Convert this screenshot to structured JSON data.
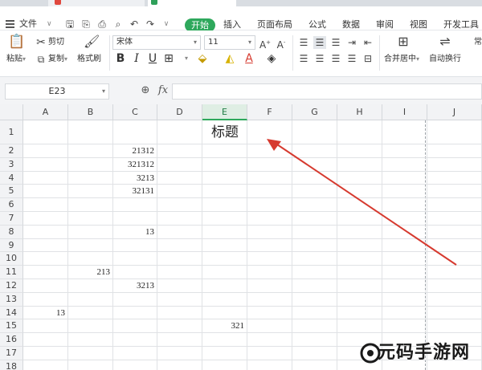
{
  "menubar": {
    "menu_label": "文件",
    "start_tab": "开始",
    "tabs": [
      "插入",
      "页面布局",
      "公式",
      "数据",
      "审阅",
      "视图",
      "开发工具"
    ]
  },
  "ribbon": {
    "cut": "剪切",
    "paste": "粘贴",
    "copy": "复制",
    "format_painter": "格式刷",
    "font_name": "宋体",
    "font_size": "11",
    "merge_center": "合并居中",
    "wrap_text": "自动换行",
    "cut_off_label": "常"
  },
  "formula_bar": {
    "name_box": "E23",
    "fx_label": "fx",
    "formula_value": ""
  },
  "sheet": {
    "columns": [
      "A",
      "B",
      "C",
      "D",
      "E",
      "F",
      "G",
      "H",
      "I",
      "J"
    ],
    "selected_column": "E",
    "rows": [
      "1",
      "2",
      "3",
      "4",
      "5",
      "6",
      "7",
      "8",
      "9",
      "10",
      "11",
      "12",
      "13",
      "14",
      "15",
      "16",
      "17",
      "18"
    ],
    "title": "标题",
    "cells": [
      {
        "ref": "C2",
        "value": "21312"
      },
      {
        "ref": "C3",
        "value": "321312"
      },
      {
        "ref": "C4",
        "value": "3213"
      },
      {
        "ref": "C5",
        "value": "32131"
      },
      {
        "ref": "C8",
        "value": "13"
      },
      {
        "ref": "B11",
        "value": "213"
      },
      {
        "ref": "C12",
        "value": "3213"
      },
      {
        "ref": "A14",
        "value": "13"
      },
      {
        "ref": "E15",
        "value": "321"
      }
    ]
  },
  "annotation": {
    "arrow_color": "#d63a2f"
  },
  "watermark": {
    "text": "元码手游网"
  },
  "colors": {
    "accent": "#2ea85c",
    "arrow": "#d63a2f",
    "header_bg": "#f2f3f5"
  }
}
